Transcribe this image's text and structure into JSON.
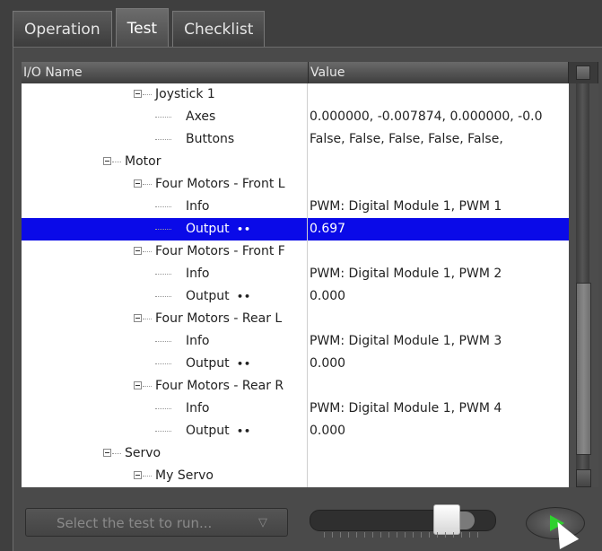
{
  "tabs": [
    {
      "label": "Operation"
    },
    {
      "label": "Test"
    },
    {
      "label": "Checklist"
    }
  ],
  "grid": {
    "headers": {
      "name": "I/O Name",
      "value": "Value"
    },
    "rows": [
      {
        "name": "Joystick 1",
        "value": "",
        "level": 1,
        "expander": true,
        "dots": false,
        "selected": false
      },
      {
        "name": "Axes",
        "value": "0.000000, -0.007874, 0.000000, -0.0",
        "level": 2,
        "expander": false,
        "dots": false,
        "selected": false
      },
      {
        "name": "Buttons",
        "value": "False, False, False, False, False,",
        "level": 2,
        "expander": false,
        "dots": false,
        "selected": false
      },
      {
        "name": "Motor",
        "value": "",
        "level": 0,
        "expander": true,
        "dots": false,
        "selected": false
      },
      {
        "name": "Four Motors - Front L",
        "value": "",
        "level": 1,
        "expander": true,
        "dots": false,
        "selected": false
      },
      {
        "name": "Info",
        "value": "PWM: Digital Module 1, PWM 1",
        "level": 2,
        "expander": false,
        "dots": false,
        "selected": false
      },
      {
        "name": "Output",
        "value": "0.697",
        "level": 2,
        "expander": false,
        "dots": true,
        "selected": true
      },
      {
        "name": "Four Motors - Front F",
        "value": "",
        "level": 1,
        "expander": true,
        "dots": false,
        "selected": false
      },
      {
        "name": "Info",
        "value": "PWM: Digital Module 1, PWM 2",
        "level": 2,
        "expander": false,
        "dots": false,
        "selected": false
      },
      {
        "name": "Output",
        "value": "0.000",
        "level": 2,
        "expander": false,
        "dots": true,
        "selected": false
      },
      {
        "name": "Four Motors - Rear L",
        "value": "",
        "level": 1,
        "expander": true,
        "dots": false,
        "selected": false
      },
      {
        "name": "Info",
        "value": "PWM: Digital Module 1, PWM 3",
        "level": 2,
        "expander": false,
        "dots": false,
        "selected": false
      },
      {
        "name": "Output",
        "value": "0.000",
        "level": 2,
        "expander": false,
        "dots": true,
        "selected": false
      },
      {
        "name": "Four Motors - Rear R",
        "value": "",
        "level": 1,
        "expander": true,
        "dots": false,
        "selected": false
      },
      {
        "name": "Info",
        "value": "PWM: Digital Module 1, PWM 4",
        "level": 2,
        "expander": false,
        "dots": false,
        "selected": false
      },
      {
        "name": "Output",
        "value": "0.000",
        "level": 2,
        "expander": false,
        "dots": true,
        "selected": false
      },
      {
        "name": "Servo",
        "value": "",
        "level": 0,
        "expander": true,
        "dots": false,
        "selected": false
      },
      {
        "name": "My Servo",
        "value": "",
        "level": 1,
        "expander": true,
        "dots": false,
        "selected": false
      }
    ]
  },
  "footer": {
    "test_select_placeholder": "Select the test to run...",
    "slider_value": 0.84,
    "dots_glyph": "••"
  },
  "colors": {
    "selection": "#0a0ae8",
    "play": "#2fd12f"
  }
}
